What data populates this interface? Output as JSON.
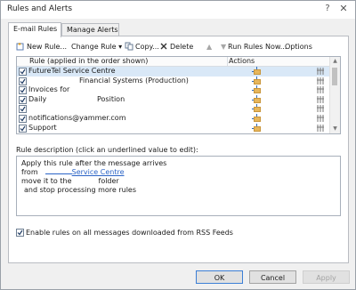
{
  "window": {
    "title": "Rules and Alerts",
    "help": "?",
    "close": "✕"
  },
  "tabs": [
    {
      "label": "E-mail Rules"
    },
    {
      "label": "Manage Alerts"
    }
  ],
  "toolbar": {
    "new_rule": "New Rule...",
    "change_rule": "Change Rule ▾",
    "copy": "Copy...",
    "delete": "Delete",
    "move_up": "▲",
    "move_down": "▼",
    "run_rules_now": "Run Rules Now...",
    "options": "Options"
  },
  "rules_list": {
    "col_rule": "Rule (applied in the order shown)",
    "col_actions": "Actions",
    "rows": [
      {
        "name": "FutureTel Service Centre",
        "sub": "",
        "checked": true,
        "selected": true
      },
      {
        "name": "",
        "sub": "Financial Systems (Production)",
        "checked": true,
        "selected": false
      },
      {
        "name": "Invoices for",
        "sub": "",
        "checked": true,
        "selected": false
      },
      {
        "name": "Daily",
        "sub": "Position",
        "checked": true,
        "selected": false
      },
      {
        "name": "",
        "sub": "",
        "checked": true,
        "selected": false
      },
      {
        "name": "notifications@yammer.com",
        "sub": "",
        "checked": true,
        "selected": false
      },
      {
        "name": "Support",
        "sub": "",
        "checked": true,
        "selected": false
      }
    ]
  },
  "description": {
    "label": "Rule description (click an underlined value to edit):",
    "line1": "Apply this rule after the message arrives",
    "line2_prefix": "from",
    "line2_link": "Service Centre",
    "line3_prefix": "move it to the",
    "line3_suffix": "folder",
    "line4": "and stop processing more rules"
  },
  "rss": {
    "label": "Enable rules on all messages downloaded from RSS Feeds",
    "checked": true
  },
  "buttons": {
    "ok": "OK",
    "cancel": "Cancel",
    "apply": "Apply"
  }
}
